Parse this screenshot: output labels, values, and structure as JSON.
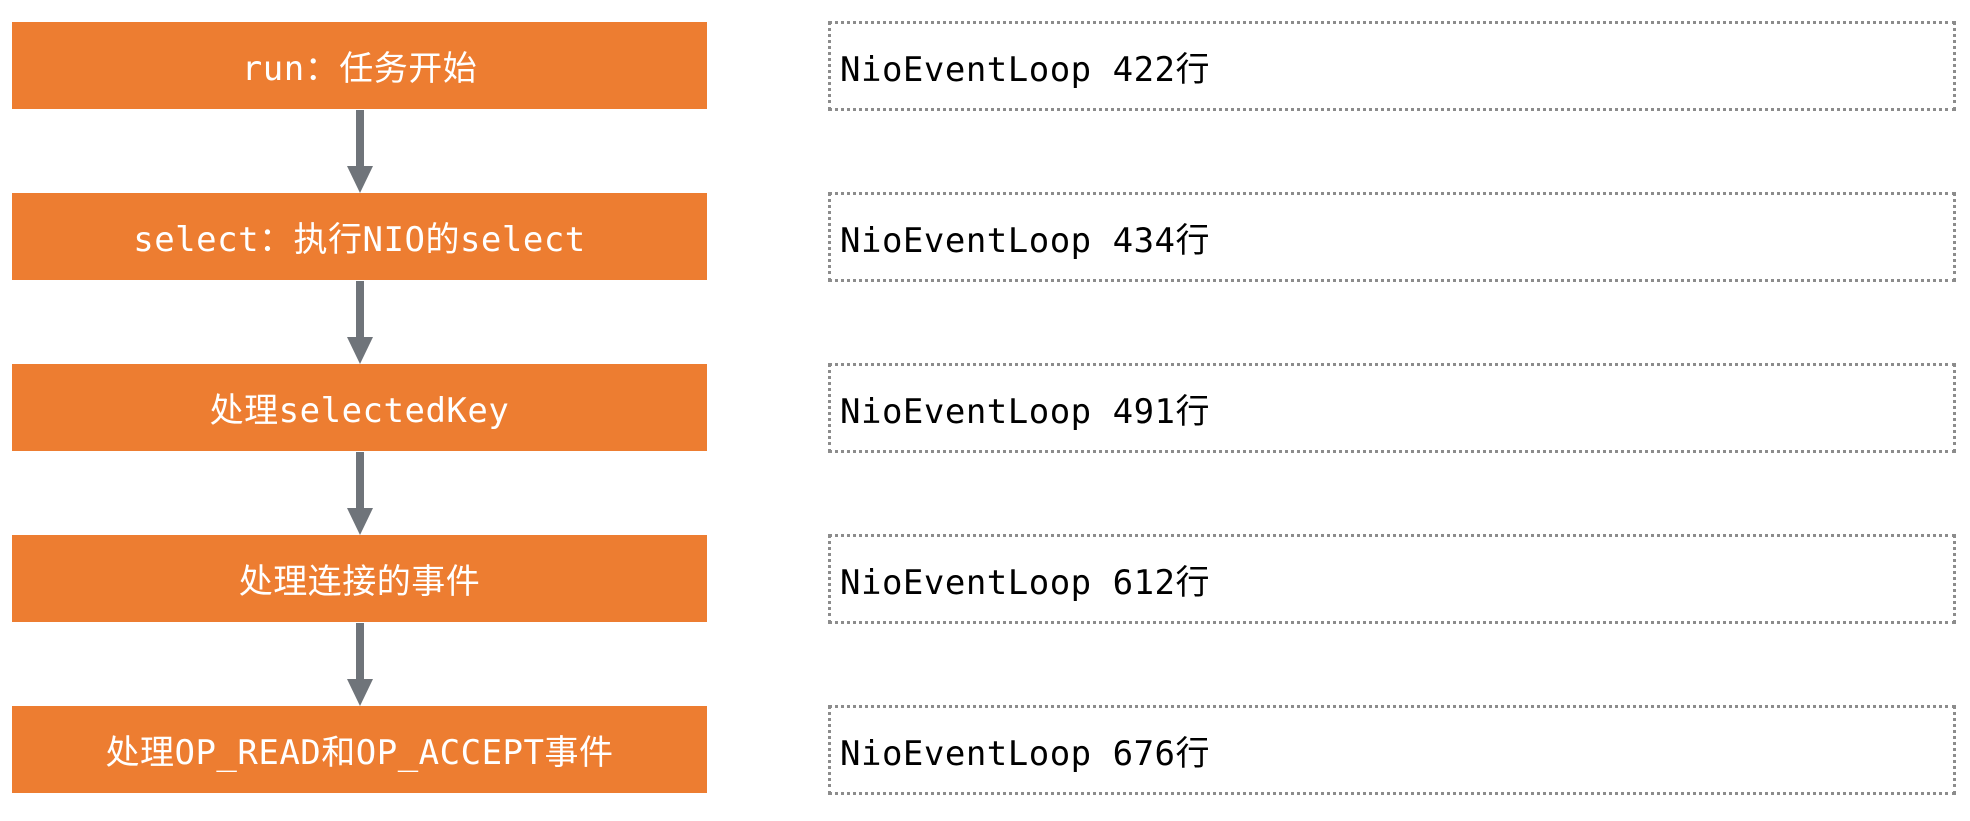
{
  "steps": [
    {
      "label": "run：任务开始"
    },
    {
      "label": "select：执行NIO的select"
    },
    {
      "label": "处理selectedKey"
    },
    {
      "label": "处理连接的事件"
    },
    {
      "label": "处理OP_READ和OP_ACCEPT事件"
    }
  ],
  "notes": [
    {
      "label": "NioEventLoop 422行"
    },
    {
      "label": "NioEventLoop 434行"
    },
    {
      "label": "NioEventLoop 491行"
    },
    {
      "label": "NioEventLoop 612行"
    },
    {
      "label": "NioEventLoop 676行"
    }
  ],
  "colors": {
    "step_fill": "#ED7D31",
    "step_text": "#FFFFFF",
    "arrow": "#6F747A",
    "note_border": "#8C8C8C"
  }
}
